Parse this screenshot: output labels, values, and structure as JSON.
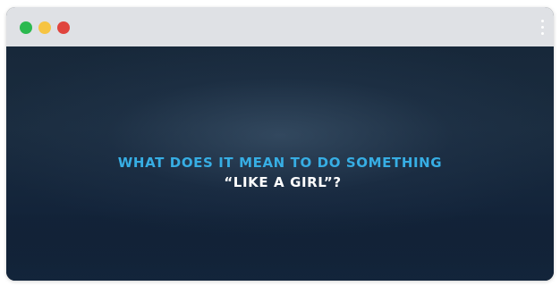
{
  "window": {
    "traffic_lights": {
      "green": "#2bb94f",
      "yellow": "#f6c443",
      "red": "#e0443e"
    },
    "menu_icon": "kebab-menu-icon"
  },
  "video": {
    "caption_line1": "WHAT DOES IT MEAN TO DO SOMETHING",
    "caption_line2": "“LIKE A GIRL”?",
    "caption_line1_color": "#37aee4",
    "caption_line2_color": "#ffffff"
  }
}
